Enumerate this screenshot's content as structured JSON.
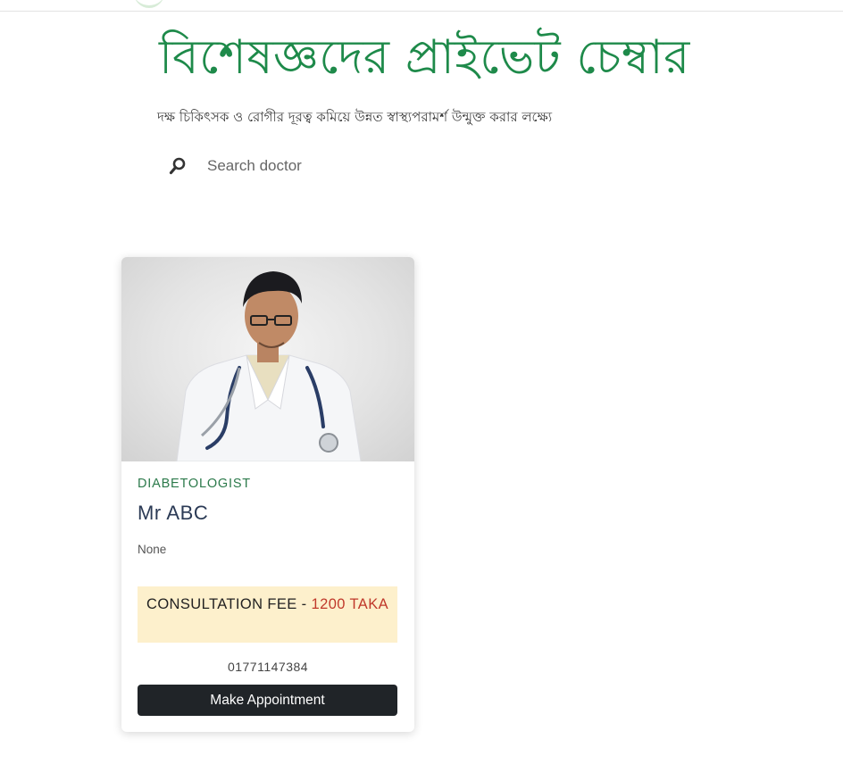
{
  "hero": {
    "title": "বিশেষজ্ঞদের প্রাইভেট চেম্বার",
    "subtitle": "দক্ষ চিকিৎসক ও রোগীর দূরত্ব কমিয়ে উন্নত স্বাস্থ্যপরামর্শ উন্মুক্ত করার লক্ষ্যে"
  },
  "search": {
    "placeholder": "Search doctor",
    "value": "",
    "icon": "search-icon"
  },
  "colors": {
    "brand_green": "#1e8a4a",
    "specialty_green": "#2c7a4b",
    "fee_bg": "#fdf0cc",
    "fee_amount": "#c0392b",
    "button_bg": "#202428"
  },
  "doctors": [
    {
      "specialty": "DIABETOLOGIST",
      "name": "Mr ABC",
      "description": "None",
      "fee_label": "CONSULTATION FEE",
      "fee_separator": " - ",
      "fee_amount": "1200 TAKA",
      "phone": "01771147384",
      "button_label": "Make Appointment"
    }
  ]
}
